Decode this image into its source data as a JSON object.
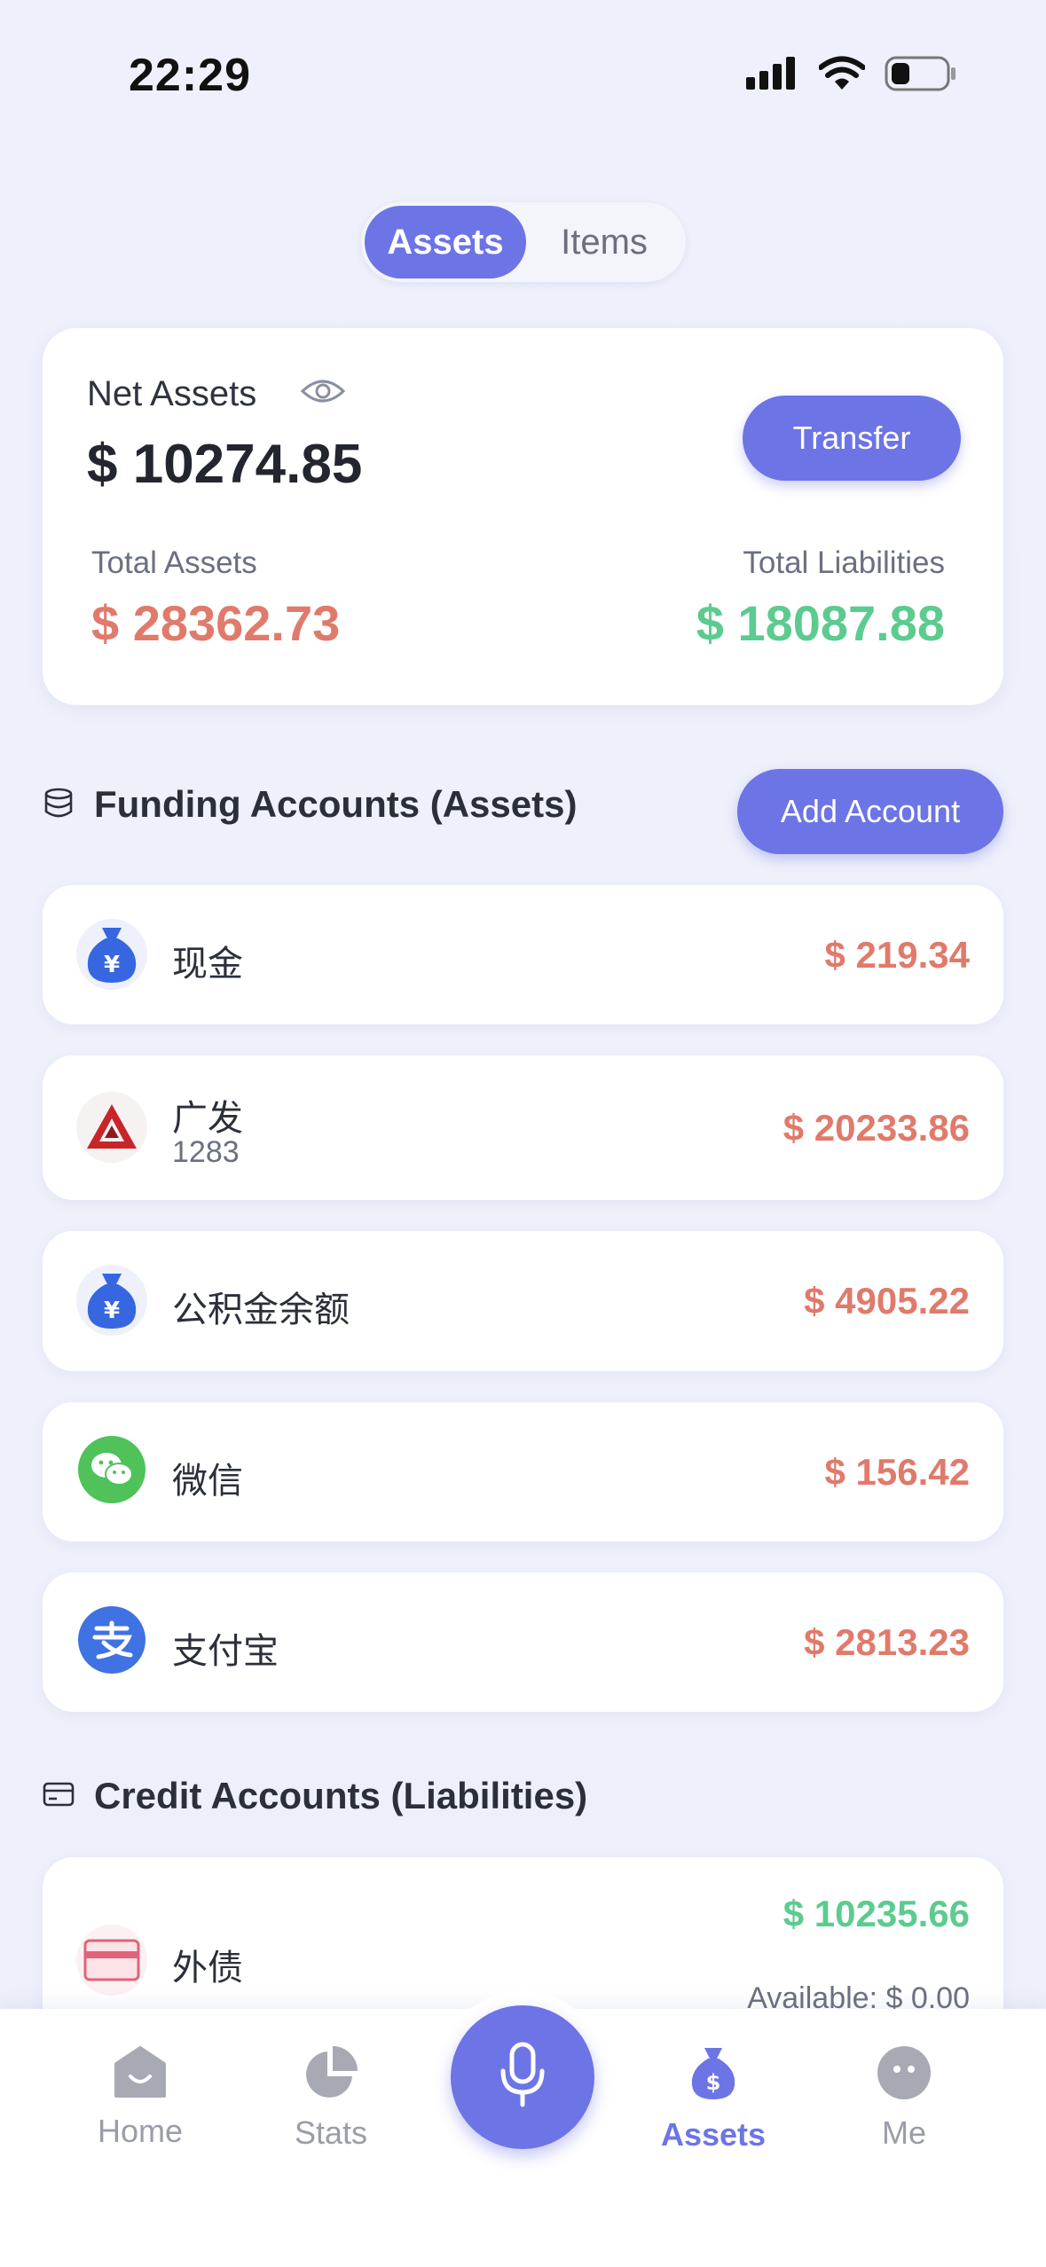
{
  "status_bar": {
    "time": "22:29"
  },
  "segment": {
    "tabs": [
      {
        "label": "Assets",
        "active": true
      },
      {
        "label": "Items",
        "active": false
      }
    ]
  },
  "summary": {
    "net_label": "Net Assets",
    "net_value": "$ 10274.85",
    "transfer_label": "Transfer",
    "total_assets_label": "Total Assets",
    "total_assets_value": "$ 28362.73",
    "total_liabilities_label": "Total Liabilities",
    "total_liabilities_value": "$ 18087.88"
  },
  "funding_section": {
    "title": "Funding Accounts (Assets)",
    "add_label": "Add Account",
    "accounts": [
      {
        "name": "现金",
        "sub": "",
        "amount": "$ 219.34",
        "icon": "money-bag-icon"
      },
      {
        "name": "广发",
        "sub": "1283",
        "amount": "$ 20233.86",
        "icon": "bank-logo-icon"
      },
      {
        "name": "公积金余额",
        "sub": "",
        "amount": "$ 4905.22",
        "icon": "money-bag-icon"
      },
      {
        "name": "微信",
        "sub": "",
        "amount": "$ 156.42",
        "icon": "wechat-icon"
      },
      {
        "name": "支付宝",
        "sub": "",
        "amount": "$ 2813.23",
        "icon": "alipay-icon"
      }
    ]
  },
  "credit_section": {
    "title": "Credit Accounts (Liabilities)",
    "accounts": [
      {
        "name": "外债",
        "amount": "$ 10235.66",
        "available": "Available: $ 0.00",
        "icon": "credit-card-icon"
      }
    ]
  },
  "nav": {
    "items": [
      {
        "label": "Home",
        "icon": "home-icon",
        "active": false
      },
      {
        "label": "Stats",
        "icon": "pie-chart-icon",
        "active": false
      },
      {
        "label": "Assets",
        "icon": "money-bag-icon",
        "active": true
      },
      {
        "label": "Me",
        "icon": "profile-face-icon",
        "active": false
      }
    ],
    "center": "microphone-icon"
  },
  "colors": {
    "accent": "#6c74e6",
    "asset_red": "#e07a6b",
    "liability_green": "#5ccb8f",
    "background": "#edf0fa"
  }
}
